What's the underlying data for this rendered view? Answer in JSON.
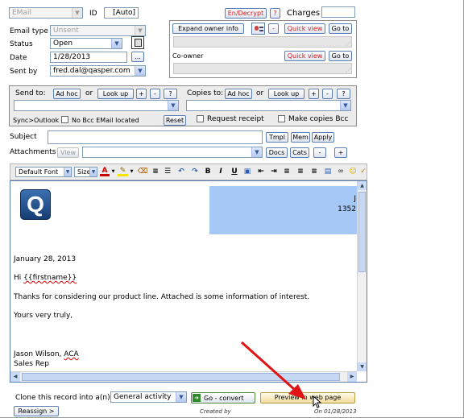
{
  "colors": {
    "accent_red": "#d21a1a",
    "banner": "#a6c8f6",
    "arrow": "#e01414"
  },
  "email_type_top": {
    "value": "EMail"
  },
  "id": {
    "label": "ID",
    "value": "[Auto]"
  },
  "en_decrypt": {
    "label": "En/Decrypt",
    "help": "?"
  },
  "charges": {
    "label": "Charges",
    "value": ""
  },
  "email_type": {
    "label": "Email type",
    "value": "Unsent"
  },
  "status": {
    "label": "Status",
    "value": "Open"
  },
  "date": {
    "label": "Date",
    "value": "1/28/2013",
    "picker": "..."
  },
  "sent_by": {
    "label": "Sent by",
    "value": "fred.dal@qasper.com"
  },
  "owner": {
    "expand": "Expand owner info",
    "minus": "-",
    "quick_view": "Quick view",
    "go_to": "Go to"
  },
  "coowner": {
    "label": "Co-owner",
    "quick_view": "Quick view",
    "go_to": "Go to"
  },
  "recipients": {
    "send_to": "Send to:",
    "ad_hoc": "Ad hoc",
    "or": "or",
    "look_up": "Look up",
    "plus": "+",
    "minus": "-",
    "help": "?",
    "copies_to": "Copies to:",
    "sync": "Sync>Outlook",
    "no_bcc": "No Bcc EMail located",
    "reset": "Reset",
    "request_receipt": "Request receipt",
    "make_copies_bcc": "Make copies Bcc"
  },
  "subject": {
    "label": "Subject",
    "value": "",
    "tmpl": "Tmpl",
    "mem": "Mem",
    "apply": "Apply"
  },
  "attachments": {
    "label": "Attachments",
    "view": "View",
    "docs": "Docs",
    "cats": "Cats",
    "minus": "-",
    "plus": "+"
  },
  "toolbar": {
    "font": "Default Font",
    "size": "Size",
    "bold": "B",
    "italic": "I",
    "underline": "U"
  },
  "editor": {
    "logo_letter": "Q",
    "banner_text_1": "J",
    "banner_text_2": "1352",
    "date_line": "January 28, 2013",
    "greeting_prefix": "Hi ",
    "greeting_token": "{{firstname}}",
    "body": "Thanks for considering our product line. Attached is some information of interest.",
    "closing": "Yours very truly,",
    "signer_name": "Jason Wilson, ",
    "signer_cred": "ACA",
    "signer_title": "Sales Rep"
  },
  "clone": {
    "label": "Clone this record into a(n)",
    "value": "General activity",
    "go_convert": "Go - convert",
    "preview": "Preview in web page"
  },
  "footer": {
    "reassign": "Reassign >",
    "created_by": "Created by",
    "created_on": "On 01/28/2013"
  }
}
